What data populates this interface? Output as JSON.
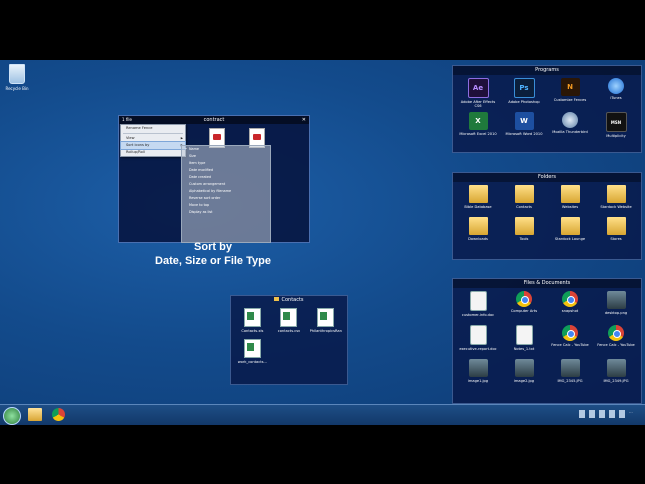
{
  "desktop": {
    "recycle_bin_label": "Recycle Bin"
  },
  "fences": {
    "programs": {
      "title": "Programs",
      "items": [
        {
          "label": "Adobe After Effects CS6",
          "icon": "Ae",
          "kind": "ae"
        },
        {
          "label": "Adobe Photoshop",
          "icon": "Ps",
          "kind": "ps"
        },
        {
          "label": "Customize Fences",
          "icon": "N",
          "kind": "ccf"
        },
        {
          "label": "iTunes",
          "icon": "",
          "kind": "itunes"
        },
        {
          "label": "Microsoft Excel 2010",
          "icon": "X",
          "kind": "excel"
        },
        {
          "label": "Microsoft Word 2010",
          "icon": "W",
          "kind": "word"
        },
        {
          "label": "Mozilla Thunderbird",
          "icon": "",
          "kind": "mozbird"
        },
        {
          "label": "Multiplicity",
          "icon": "MSN",
          "kind": "msn"
        }
      ]
    },
    "folders": {
      "title": "Folders",
      "items": [
        {
          "label": "Bible Database",
          "kind": "folder"
        },
        {
          "label": "Contacts",
          "kind": "folder"
        },
        {
          "label": "Websites",
          "kind": "folder"
        },
        {
          "label": "Stardock Website",
          "kind": "folder"
        },
        {
          "label": "Downloads",
          "kind": "folder"
        },
        {
          "label": "Tools",
          "kind": "folder"
        },
        {
          "label": "Stardock Lounge",
          "kind": "folder"
        },
        {
          "label": "Stores",
          "kind": "folder"
        }
      ]
    },
    "files": {
      "title": "Files & Documents",
      "items": [
        {
          "label": "customer-info.doc",
          "kind": "doc"
        },
        {
          "label": "Computer Arts",
          "kind": "chrome"
        },
        {
          "label": "snapshot",
          "kind": "chrome"
        },
        {
          "label": "desktop.png",
          "kind": "img"
        },
        {
          "label": "executive-report.doc",
          "kind": "doc"
        },
        {
          "label": "Notes_1.txt",
          "kind": "doc"
        },
        {
          "label": "Fence Calc - YouTube",
          "kind": "chrome"
        },
        {
          "label": "Fence Calc - YouTube",
          "kind": "chrome"
        },
        {
          "label": "image1.jpg",
          "kind": "img"
        },
        {
          "label": "image2.jpg",
          "kind": "img"
        },
        {
          "label": "IMG_2345.JPG",
          "kind": "img"
        },
        {
          "label": "IMG_2349.JPG",
          "kind": "img"
        }
      ]
    }
  },
  "contract_window": {
    "title": "contract",
    "left_label": "1 file",
    "close_glyph": "✕",
    "context_menu": [
      {
        "label": "Rename Fence",
        "highlighted": false
      },
      {
        "label": "View",
        "highlighted": false,
        "has_sub": true
      },
      {
        "label": "Sort icons by",
        "highlighted": true,
        "has_sub": true
      },
      {
        "label": "Rollup/Roll",
        "highlighted": false
      }
    ],
    "submenu": [
      {
        "label": "Name",
        "checked": true
      },
      {
        "label": "Size",
        "checked": false
      },
      {
        "label": "Item type",
        "checked": false
      },
      {
        "label": "Date modified",
        "checked": false
      },
      {
        "label": "Date created",
        "checked": false
      },
      {
        "label": "Custom arrangement",
        "checked": false
      },
      {
        "label": "Alphabetical by filename",
        "checked": false
      },
      {
        "label": "Reverse sort order",
        "checked": false
      },
      {
        "label": "Move to top",
        "checked": false
      },
      {
        "label": "Display as list",
        "checked": false
      }
    ]
  },
  "caption": {
    "line1": "Sort by",
    "line2": "Date, Size or File Type"
  },
  "contacts_fence": {
    "title": "Contacts",
    "items": [
      {
        "label": "Contacts.xls",
        "kind": "excel"
      },
      {
        "label": "contacts.csv",
        "kind": "excel"
      },
      {
        "label": "PhilanthropicsRank...",
        "kind": "excel"
      },
      {
        "label": "work_contacts...",
        "kind": "excel"
      }
    ]
  },
  "taskbar": {
    "clock": "..."
  }
}
